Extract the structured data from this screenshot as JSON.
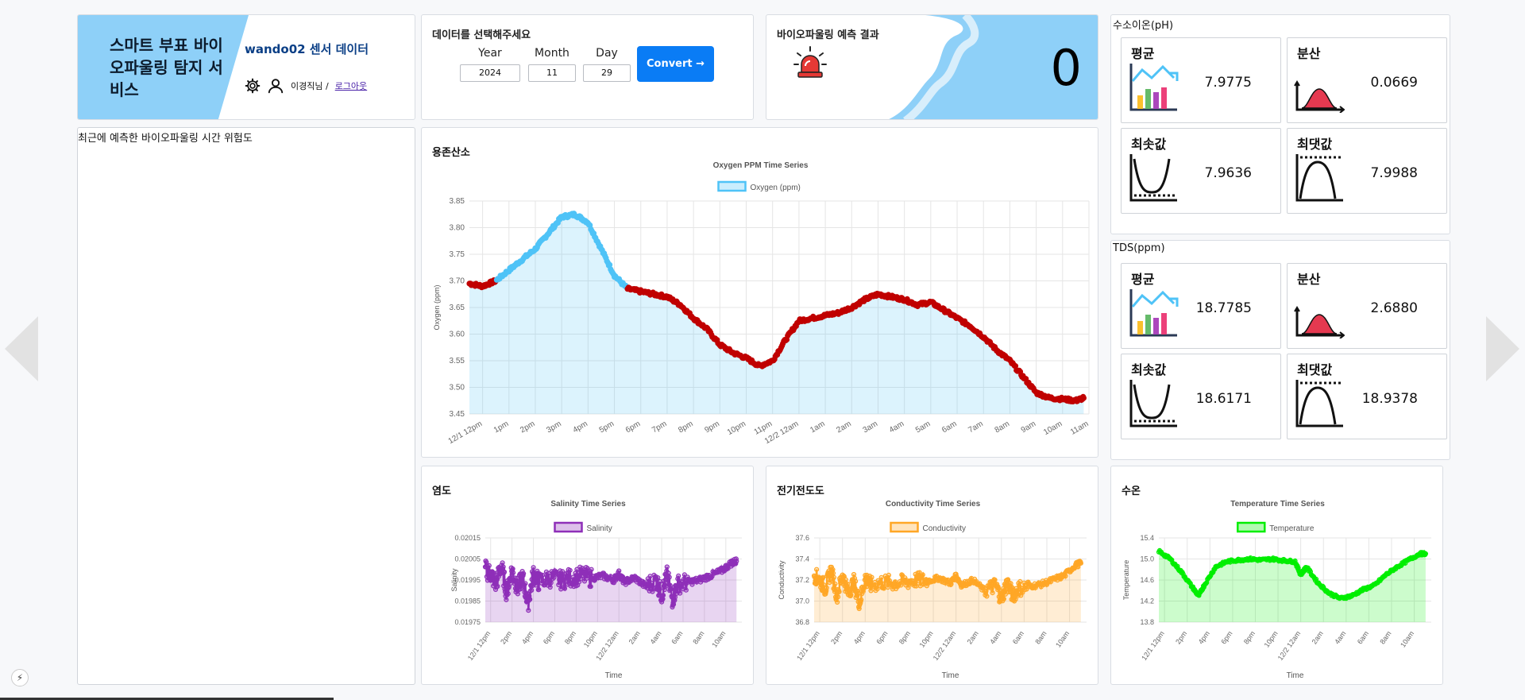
{
  "header": {
    "title": "스마트 부표 바이오파울링 탐지 서비스",
    "sensor_data": "wando02 센서 데이터",
    "user_name": "이경직님 /",
    "logout": "로그아웃"
  },
  "date_select": {
    "title": "데이터를 선택해주세요",
    "year_label": "Year",
    "month_label": "Month",
    "day_label": "Day",
    "year": "2024",
    "month": "11",
    "day": "29",
    "convert_label": "Convert →"
  },
  "prediction": {
    "title": "바이오파울링 예측 결과",
    "result": "0",
    "icon": "siren-icon"
  },
  "risk": {
    "title": "최근에 예측한 바이오파울링 시간 위험도"
  },
  "ph": {
    "title": "수소이온(pH)",
    "stats": [
      {
        "label": "평균",
        "value": "7.9775",
        "icon": "bar-chart-icon"
      },
      {
        "label": "분산",
        "value": "0.0669",
        "icon": "distribution-icon"
      },
      {
        "label": "최솟값",
        "value": "7.9636",
        "icon": "min-curve-icon"
      },
      {
        "label": "최댓값",
        "value": "7.9988",
        "icon": "max-curve-icon"
      }
    ]
  },
  "tds": {
    "title": "TDS(ppm)",
    "stats": [
      {
        "label": "평균",
        "value": "18.7785",
        "icon": "bar-chart-icon"
      },
      {
        "label": "분산",
        "value": "2.6880",
        "icon": "distribution-icon"
      },
      {
        "label": "최솟값",
        "value": "18.6171",
        "icon": "min-curve-icon"
      },
      {
        "label": "최댓값",
        "value": "18.9378",
        "icon": "max-curve-icon"
      }
    ]
  },
  "colors": {
    "accent": "#0a7cf5",
    "brand_blue": "#8ed0f8",
    "oxygen": "#4fc3f7",
    "oxygen_flag": "#c00000",
    "salinity": "#8e2fb8",
    "conductivity": "#ffa726",
    "temperature": "#00ee00"
  },
  "chart_data": [
    {
      "type": "line",
      "card_title": "용존산소",
      "title": "Oxygen PPM Time Series",
      "legend": "Oxygen (ppm)",
      "ylabel": "Oxygen (ppm)",
      "xlabel": "",
      "ylim": [
        3.45,
        3.85
      ],
      "yticks": [
        "3.85",
        "3.80",
        "3.75",
        "3.70",
        "3.65",
        "3.60",
        "3.55",
        "3.50",
        "3.45"
      ],
      "xticks": [
        "12/1 12pm",
        "1pm",
        "2pm",
        "3pm",
        "4pm",
        "5pm",
        "6pm",
        "7pm",
        "8pm",
        "9pm",
        "10pm",
        "11pm",
        "12/2 12am",
        "1am",
        "2am",
        "3am",
        "4am",
        "5am",
        "6am",
        "7am",
        "8am",
        "9am",
        "10am",
        "11am"
      ],
      "x": [
        0,
        0.5,
        1,
        1.5,
        2,
        2.5,
        3,
        3.5,
        4,
        4.5,
        5,
        5.5,
        6,
        6.5,
        7,
        7.5,
        8,
        8.5,
        9,
        9.5,
        10,
        10.5,
        11,
        11.5,
        12,
        12.5,
        13,
        13.5,
        14,
        14.5,
        15,
        15.5,
        16,
        16.5,
        17,
        17.5,
        18,
        18.5,
        19,
        19.5,
        20,
        20.5,
        21,
        21.5,
        22,
        22.5,
        23,
        23.3
      ],
      "values": [
        3.695,
        3.69,
        3.7,
        3.72,
        3.74,
        3.76,
        3.79,
        3.82,
        3.825,
        3.81,
        3.76,
        3.71,
        3.685,
        3.68,
        3.675,
        3.67,
        3.655,
        3.63,
        3.61,
        3.58,
        3.565,
        3.555,
        3.54,
        3.55,
        3.59,
        3.625,
        3.63,
        3.635,
        3.64,
        3.65,
        3.665,
        3.675,
        3.67,
        3.665,
        3.655,
        3.66,
        3.645,
        3.63,
        3.615,
        3.595,
        3.57,
        3.55,
        3.52,
        3.49,
        3.48,
        3.478,
        3.475,
        3.48
      ],
      "flag_ranges": [
        [
          0,
          1
        ],
        [
          6,
          23.3
        ]
      ],
      "grid": true,
      "legend_position": "top"
    },
    {
      "type": "line",
      "card_title": "염도",
      "title": "Salinity Time Series",
      "legend": "Salinity",
      "ylabel": "Salinity",
      "xlabel": "Time",
      "ylim": [
        0.01975,
        0.02015
      ],
      "yticks": [
        "0.02015",
        "0.02005",
        "0.01995",
        "0.01985",
        "0.01975"
      ],
      "xticks": [
        "12/1 12pm",
        "2pm",
        "4pm",
        "6pm",
        "8pm",
        "10pm",
        "12/2 12am",
        "2am",
        "4am",
        "6am",
        "8am",
        "10am"
      ],
      "x": [
        0,
        0.5,
        1,
        1.5,
        2,
        2.5,
        3,
        3.5,
        4,
        4.5,
        5,
        6,
        7,
        8,
        9,
        10,
        11,
        12,
        12.5,
        13,
        14,
        15,
        16,
        16.5,
        17,
        17.5,
        18,
        19,
        20,
        21,
        22,
        23,
        23.5
      ],
      "values": [
        0.02,
        0.01998,
        0.01993,
        0.02002,
        0.01989,
        0.02,
        0.01991,
        0.01996,
        0.01984,
        0.01998,
        0.01994,
        0.01996,
        0.01995,
        0.01996,
        0.01997,
        0.01996,
        0.01997,
        0.01995,
        0.01998,
        0.01994,
        0.01996,
        0.01992,
        0.01995,
        0.01988,
        0.01997,
        0.01986,
        0.01993,
        0.01994,
        0.01995,
        0.01997,
        0.01999,
        0.02003,
        0.02004
      ],
      "grid": true,
      "legend_position": "top"
    },
    {
      "type": "line",
      "card_title": "전기전도도",
      "title": "Conductivity Time Series",
      "legend": "Conductivity",
      "ylabel": "Conductivity",
      "xlabel": "Time",
      "ylim": [
        36.8,
        37.6
      ],
      "yticks": [
        "37.6",
        "37.4",
        "37.2",
        "37.0",
        "36.8"
      ],
      "xticks": [
        "12/1 12pm",
        "2pm",
        "4pm",
        "6pm",
        "8pm",
        "10pm",
        "12/2 12am",
        "2am",
        "4am",
        "6am",
        "8am",
        "10am"
      ],
      "x": [
        0,
        0.5,
        1,
        1.5,
        2,
        2.5,
        3,
        3.5,
        4,
        4.5,
        5,
        6,
        7,
        8,
        9,
        10,
        11,
        12,
        12.5,
        13,
        14,
        15,
        16,
        16.5,
        17,
        17.5,
        18,
        19,
        20,
        21,
        22,
        23,
        23.5
      ],
      "values": [
        37.25,
        37.2,
        37.12,
        37.3,
        37.05,
        37.25,
        37.08,
        37.18,
        36.98,
        37.22,
        37.15,
        37.18,
        37.17,
        37.18,
        37.2,
        37.19,
        37.22,
        37.17,
        37.24,
        37.15,
        37.2,
        37.1,
        37.15,
        37.02,
        37.18,
        37.05,
        37.12,
        37.14,
        37.16,
        37.2,
        37.24,
        37.34,
        37.36
      ],
      "grid": true,
      "legend_position": "top"
    },
    {
      "type": "line",
      "card_title": "수온",
      "title": "Temperature Time Series",
      "legend": "Temperature",
      "ylabel": "Temperature",
      "xlabel": "Time",
      "ylim": [
        13.8,
        15.4
      ],
      "yticks": [
        "15.4",
        "15.0",
        "14.6",
        "14.2",
        "13.8"
      ],
      "xticks": [
        "12/1 12pm",
        "2pm",
        "4pm",
        "6pm",
        "8pm",
        "10pm",
        "12/2 12am",
        "2am",
        "4am",
        "6am",
        "8am",
        "10am"
      ],
      "x": [
        0,
        1,
        2,
        3,
        3.5,
        4,
        5,
        6,
        7,
        8,
        9,
        10,
        11,
        12,
        12.5,
        13,
        14,
        15,
        16,
        17,
        18,
        19,
        20,
        21,
        22,
        23,
        23.5
      ],
      "values": [
        15.15,
        15.0,
        14.75,
        14.45,
        14.3,
        14.5,
        14.85,
        14.95,
        14.98,
        15.0,
        14.98,
        15.0,
        14.97,
        14.95,
        14.7,
        14.85,
        14.55,
        14.35,
        14.25,
        14.3,
        14.42,
        14.5,
        14.7,
        14.85,
        14.98,
        15.1,
        15.1
      ],
      "grid": true,
      "legend_position": "top"
    }
  ]
}
